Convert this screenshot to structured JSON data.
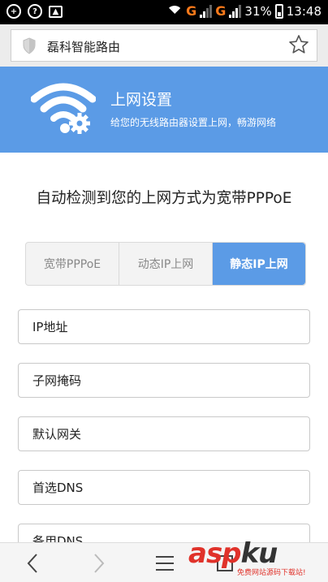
{
  "status_bar": {
    "battery_percent": "31%",
    "time": "13:48",
    "network_label": "G"
  },
  "browser": {
    "page_title": "磊科智能路由"
  },
  "banner": {
    "title": "上网设置",
    "subtitle": "给您的无线路由器设置上网，畅游网络"
  },
  "main": {
    "headline": "自动检测到您的上网方式为宽带PPPoE",
    "tabs": [
      {
        "label": "宽带PPPoE",
        "active": false
      },
      {
        "label": "动态IP上网",
        "active": false
      },
      {
        "label": "静态IP上网",
        "active": true
      }
    ],
    "fields": {
      "ip_placeholder": "IP地址",
      "mask_placeholder": "子网掩码",
      "gateway_placeholder": "默认网关",
      "dns1_placeholder": "首选DNS",
      "dns2_placeholder": "备用DNS"
    }
  },
  "watermark": {
    "text_main": "asp",
    "text_ku": "ku",
    "text_sub": "免费网站源码下载站!"
  },
  "colors": {
    "accent": "#5b9be6",
    "status_bar": "#000000",
    "network_orange": "#ff7a1a",
    "watermark_red": "#e0322a"
  }
}
